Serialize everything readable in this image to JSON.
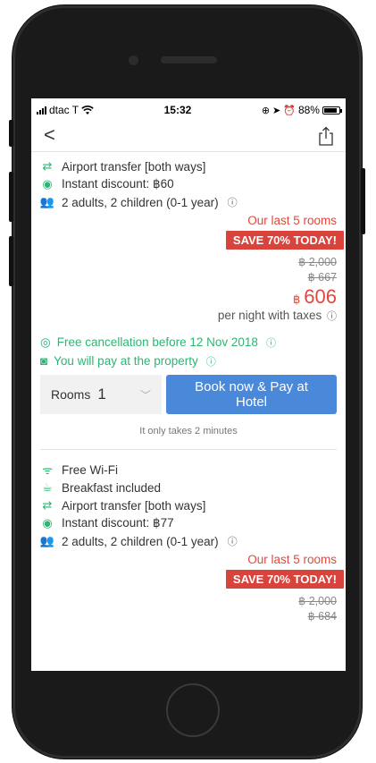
{
  "status_bar": {
    "carrier": "dtac T",
    "time": "15:32",
    "battery": "88%",
    "battery_level": 0.88
  },
  "nav": {
    "back_icon": "chevron-left-icon",
    "share_icon": "share-icon"
  },
  "offer1": {
    "features": [
      {
        "icon": "airport-transfer-icon",
        "text": "Airport transfer [both ways]"
      },
      {
        "icon": "discount-icon",
        "text": "Instant discount: ฿60"
      },
      {
        "icon": "guests-icon",
        "text": "2 adults, 2 children (0-1 year)"
      }
    ],
    "last_rooms": "Our last 5 rooms",
    "save_badge": "SAVE 70% TODAY!",
    "old_price_1": "฿ 2,000",
    "old_price_2": "฿ 667",
    "currency": "฿",
    "price": "606",
    "per_night": "per night with taxes",
    "free_cancellation": "Free cancellation before 12 Nov 2018",
    "pay_at_property": "You will pay at the property",
    "rooms_label": "Rooms",
    "rooms_value": "1",
    "book_button": "Book now & Pay at Hotel",
    "takes_time": "It only takes 2 minutes"
  },
  "offer2": {
    "features": [
      {
        "icon": "wifi-icon",
        "text": "Free Wi-Fi"
      },
      {
        "icon": "breakfast-icon",
        "text": "Breakfast included"
      },
      {
        "icon": "airport-transfer-icon",
        "text": "Airport transfer [both ways]"
      },
      {
        "icon": "discount-icon",
        "text": "Instant discount: ฿77"
      },
      {
        "icon": "guests-icon",
        "text": "2 adults, 2 children (0-1 year)"
      }
    ],
    "last_rooms": "Our last 5 rooms",
    "save_badge": "SAVE 70% TODAY!",
    "old_price_1": "฿ 2,000",
    "old_price_2": "฿ 684"
  },
  "colors": {
    "accent_blue": "#4a88da",
    "sale_red": "#e1483c",
    "badge_red": "#d8433c",
    "success_green": "#2bb673"
  }
}
